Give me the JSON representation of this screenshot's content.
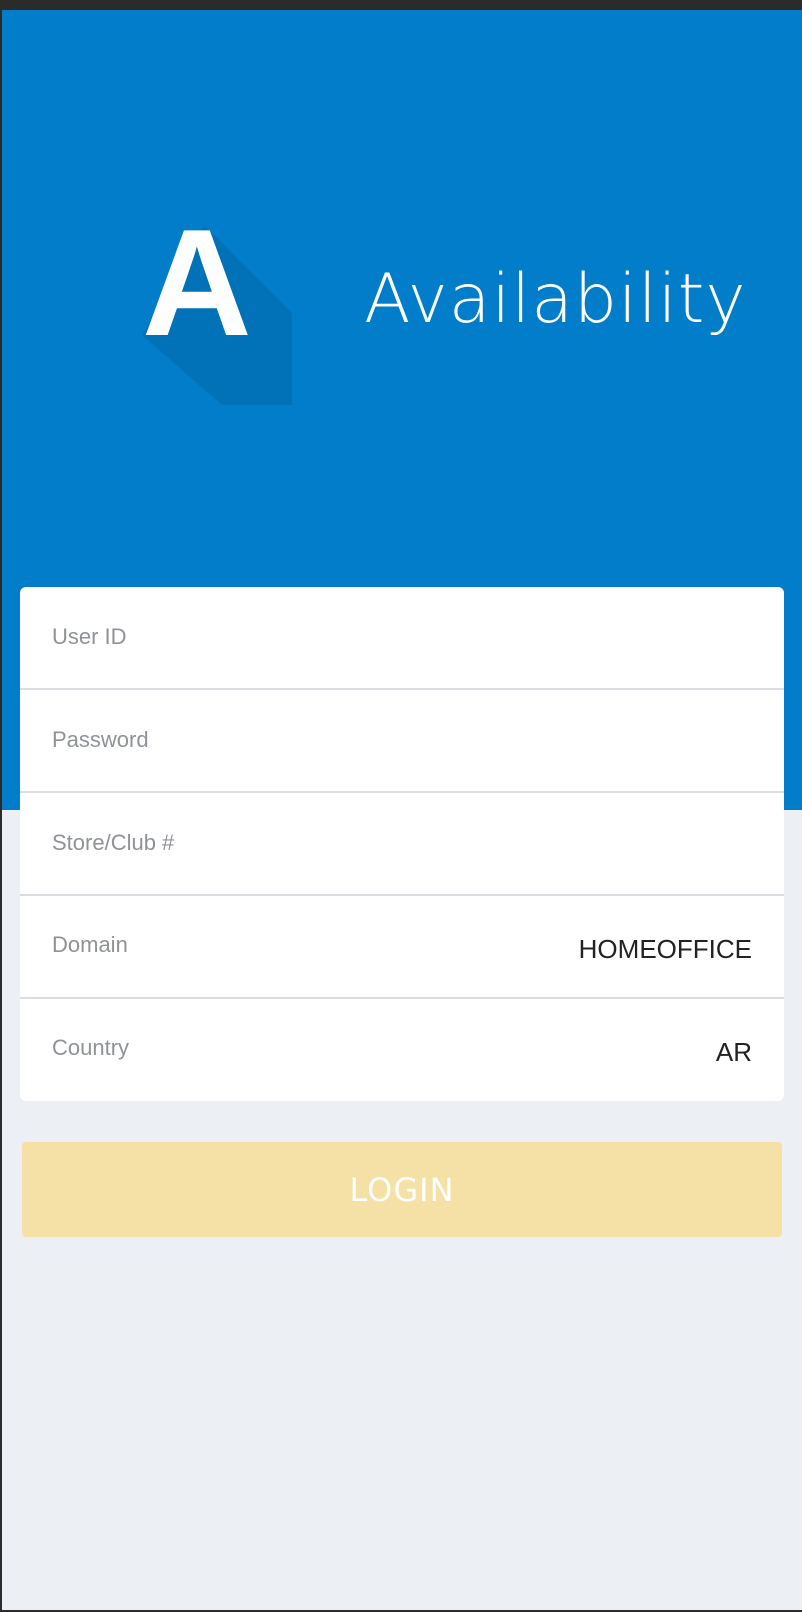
{
  "app": {
    "logo_letter": "A",
    "title": "Availability"
  },
  "form": {
    "user_id": {
      "placeholder": "User ID",
      "value": ""
    },
    "password": {
      "placeholder": "Password",
      "value": ""
    },
    "store_club": {
      "placeholder": "Store/Club #",
      "value": ""
    },
    "domain": {
      "label": "Domain",
      "value": "HOMEOFFICE"
    },
    "country": {
      "label": "Country",
      "value": "AR"
    }
  },
  "login_button": {
    "label": "LOGIN",
    "color": "#f5e0a6"
  },
  "colors": {
    "header_bg": "#027dc9",
    "page_bg": "#eceff3"
  }
}
